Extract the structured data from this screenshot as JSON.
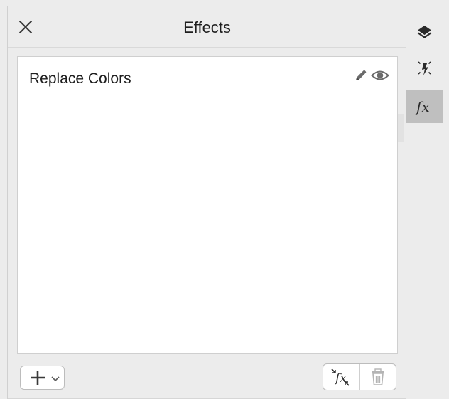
{
  "panel": {
    "title": "Effects",
    "close_icon": "close-icon"
  },
  "effects": [
    {
      "name": "Replace Colors",
      "edit_icon": "pencil-icon",
      "visibility_icon": "eye-icon"
    }
  ],
  "toolbar": {
    "add_icon": "plus-icon",
    "add_dropdown_icon": "chevron-down-icon",
    "fx_icon": "fx-collapse-icon",
    "delete_icon": "trash-icon"
  },
  "side_tabs": [
    {
      "icon": "layers-icon",
      "active": false
    },
    {
      "icon": "sparkle-icon",
      "active": false
    },
    {
      "icon": "fx-icon",
      "active": true
    }
  ],
  "colors": {
    "background": "#ececec",
    "list_background": "#ffffff",
    "active_tab": "#bfbfbf",
    "text": "#1d1d1d",
    "icon": "#555555"
  }
}
